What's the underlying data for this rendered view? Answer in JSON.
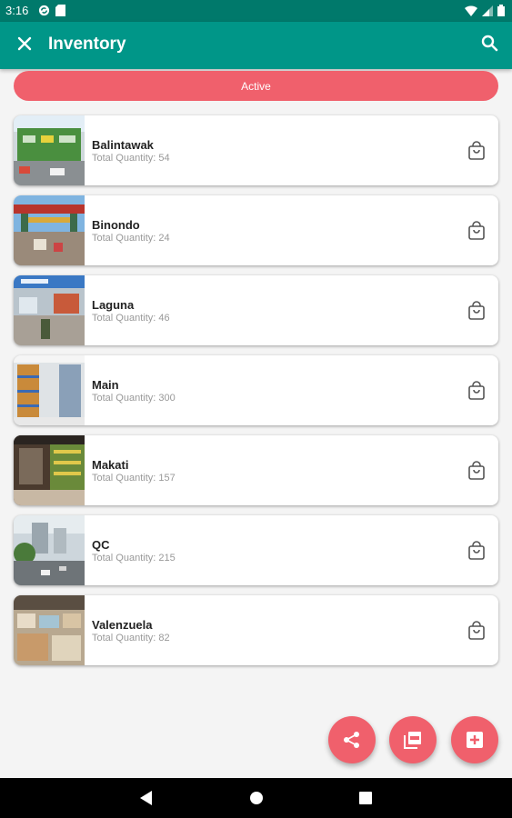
{
  "status_bar": {
    "time": "3:16"
  },
  "app_bar": {
    "title": "Inventory"
  },
  "filter": {
    "label": "Active"
  },
  "locations": [
    {
      "name": "Balintawak",
      "quantity": "Total Quantity: 54"
    },
    {
      "name": "Binondo",
      "quantity": "Total Quantity: 24"
    },
    {
      "name": "Laguna",
      "quantity": "Total Quantity: 46"
    },
    {
      "name": "Main",
      "quantity": "Total Quantity: 300"
    },
    {
      "name": "Makati",
      "quantity": "Total Quantity: 157"
    },
    {
      "name": "QC",
      "quantity": "Total Quantity: 215"
    },
    {
      "name": "Valenzuela",
      "quantity": "Total Quantity: 82"
    }
  ],
  "icons": {
    "close": "close-icon",
    "search": "search-icon",
    "bag": "shopping-bag-icon",
    "share": "share-icon",
    "pdf": "pdf-icon",
    "add": "add-box-icon"
  },
  "colors": {
    "status_bar": "#00796b",
    "app_bar": "#009688",
    "accent": "#f0606c",
    "background": "#f4f4f4"
  }
}
